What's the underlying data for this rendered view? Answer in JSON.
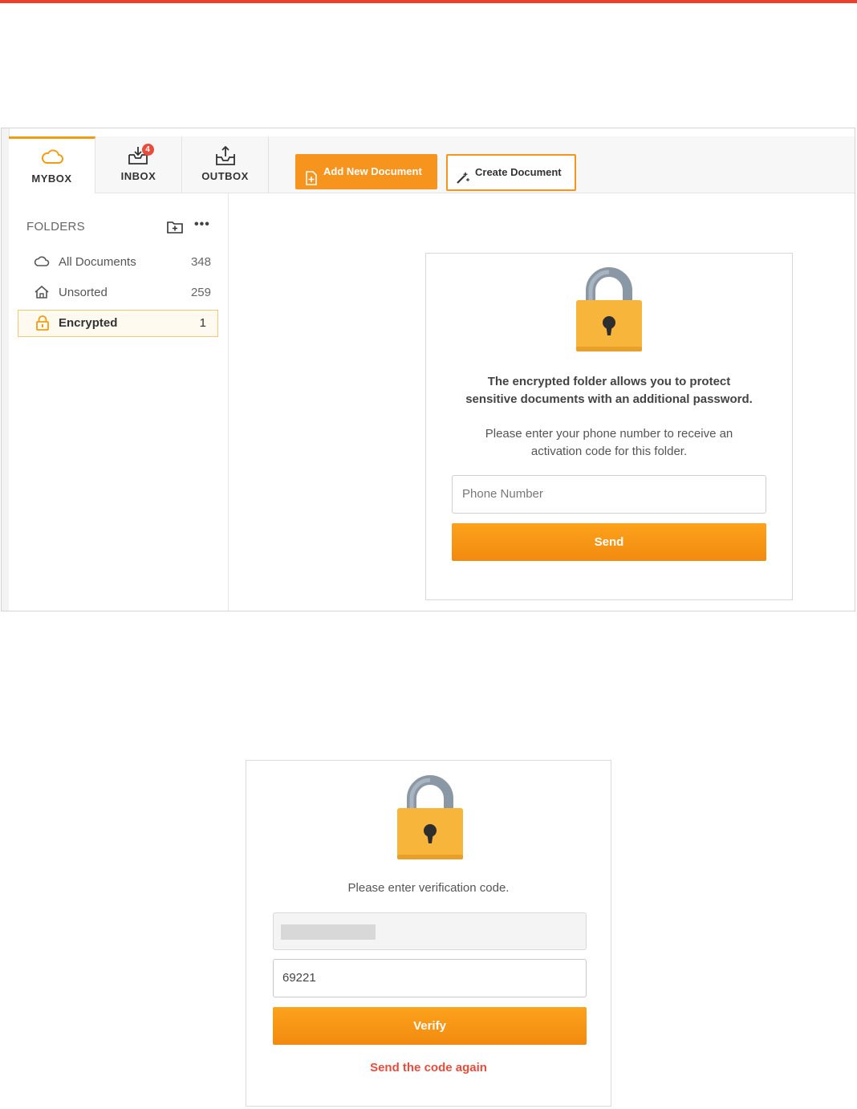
{
  "colors": {
    "accent_line": "#e8412e",
    "orange": "#f7941d",
    "link_red": "#e84c3d"
  },
  "tabs": [
    {
      "label": "MYBOX",
      "icon": "cloud-icon",
      "active": true
    },
    {
      "label": "INBOX",
      "icon": "inbox-icon",
      "badge": "4"
    },
    {
      "label": "OUTBOX",
      "icon": "outbox-icon"
    }
  ],
  "toolbar": {
    "add_label": "Add New Document",
    "create_label": "Create Document"
  },
  "sidebar": {
    "header": "FOLDERS",
    "items": [
      {
        "label": "All Documents",
        "count": "348",
        "icon": "cloud-icon"
      },
      {
        "label": "Unsorted",
        "count": "259",
        "icon": "home-icon"
      },
      {
        "label": "Encrypted",
        "count": "1",
        "icon": "lock-icon",
        "selected": true
      }
    ]
  },
  "encrypt_card": {
    "line1": "The encrypted folder allows you to protect",
    "line2": "sensitive documents with an additional password.",
    "line3": "Please enter your phone number to receive an",
    "line4": "activation code for this folder.",
    "phone_placeholder": "Phone Number",
    "send_label": "Send"
  },
  "verify_card": {
    "prompt": "Please enter verification code.",
    "code_value": "69221",
    "verify_label": "Verify",
    "resend_label": "Send the code again"
  }
}
